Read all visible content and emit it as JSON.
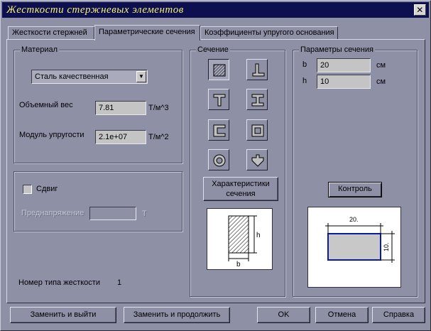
{
  "window": {
    "title": "Жесткости стержневых элементов",
    "close_glyph": "✕"
  },
  "tabs": [
    {
      "label": "Жесткости стержней"
    },
    {
      "label": "Параметрические сечения"
    },
    {
      "label": "Коэффициенты упругого основания"
    }
  ],
  "material": {
    "group_title": "Материал",
    "selected": "Сталь качественная",
    "weight_label": "Объемный вес",
    "weight_value": "7.81",
    "weight_unit": "Т/м^3",
    "modulus_label": "Модуль упругости",
    "modulus_value": "2.1e+07",
    "modulus_unit": "Т/м^2"
  },
  "shear": {
    "checkbox_label": "Сдвиг",
    "checked": false,
    "prestress_label": "Преднапряжение",
    "prestress_value": "",
    "prestress_unit": "Т"
  },
  "stiffness_type": {
    "label": "Номер типа жесткости",
    "value": "1"
  },
  "section": {
    "group_title": "Сечение",
    "shapes": [
      {
        "icon": "rectangle-section-icon",
        "selected": true
      },
      {
        "icon": "angle-section-icon",
        "selected": false
      },
      {
        "icon": "tee-section-icon",
        "selected": false
      },
      {
        "icon": "i-beam-section-icon",
        "selected": false
      },
      {
        "icon": "channel-section-icon",
        "selected": false
      },
      {
        "icon": "box-section-icon",
        "selected": false
      },
      {
        "icon": "ring-section-icon",
        "selected": false
      },
      {
        "icon": "cross-section-icon",
        "selected": false
      }
    ],
    "characteristics_button": "Характеристики\nсечения",
    "preview_labels": {
      "h": "h",
      "b": "b"
    }
  },
  "params": {
    "group_title": "Параметры сечения",
    "b_label": "b",
    "b_value": "20",
    "b_unit": "см",
    "h_label": "h",
    "h_value": "10",
    "h_unit": "см",
    "control_button": "Контроль",
    "preview_width_label": "20.",
    "preview_height_label": "10."
  },
  "buttons": {
    "replace_exit": "Заменить и выйти",
    "replace_continue": "Заменить и продолжить",
    "ok": "OK",
    "cancel": "Отмена",
    "help": "Справка"
  },
  "colors": {
    "title_bg": "#0d0f4f",
    "title_fg": "#f3f07a",
    "window_bg": "#8e90a6",
    "accent_blue": "#0c1aa0"
  }
}
